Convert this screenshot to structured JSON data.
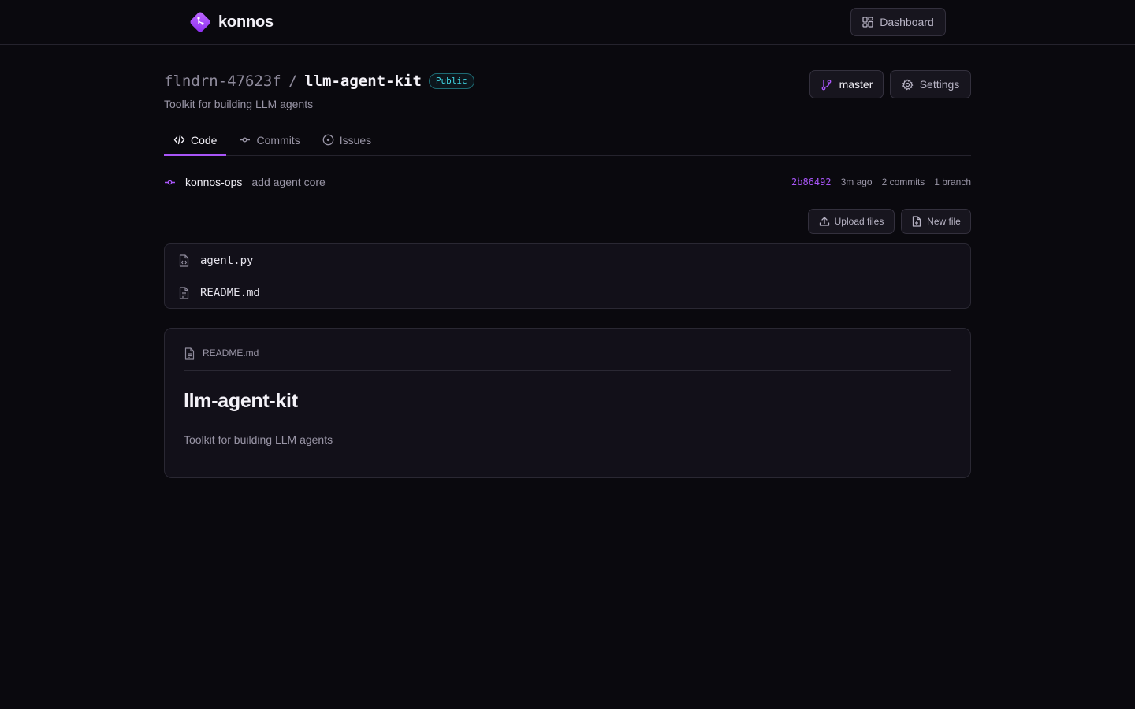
{
  "brand": {
    "name": "konnos"
  },
  "header": {
    "dashboard_label": "Dashboard"
  },
  "repo": {
    "owner": "flndrn-47623f",
    "separator": "/",
    "name": "llm-agent-kit",
    "visibility": "Public",
    "description": "Toolkit for building LLM agents",
    "branch_label": "master",
    "settings_label": "Settings"
  },
  "tabs": [
    {
      "label": "Code",
      "icon": "code-icon",
      "active": true
    },
    {
      "label": "Commits",
      "icon": "commit-icon",
      "active": false
    },
    {
      "label": "Issues",
      "icon": "issue-icon",
      "active": false
    }
  ],
  "last_commit": {
    "author": "konnos-ops",
    "message": "add agent core",
    "sha": "2b86492",
    "time": "3m ago",
    "commits": "2 commits",
    "branches": "1 branch"
  },
  "actions": {
    "upload_label": "Upload files",
    "new_file_label": "New file"
  },
  "files": [
    {
      "name": "agent.py",
      "icon": "code-file-icon"
    },
    {
      "name": "README.md",
      "icon": "text-file-icon"
    }
  ],
  "readme": {
    "filename": "README.md",
    "heading": "llm-agent-kit",
    "body": "Toolkit for building LLM agents"
  },
  "colors": {
    "accent": "#a855f7",
    "background": "#0a090e",
    "badge": "#3fd4e2"
  }
}
